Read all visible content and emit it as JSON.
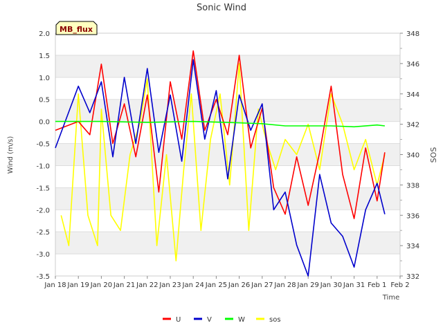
{
  "chart_data": {
    "type": "line",
    "title": "Sonic Wind",
    "xlabel": "Time",
    "ylabel": "Wind (m/s)",
    "y2label": "SOS",
    "site_label": "MB_flux",
    "xlim": [
      "2024-01-18",
      "2024-02-02"
    ],
    "ylim": [
      -3.5,
      2.0
    ],
    "y2lim": [
      332,
      348
    ],
    "x_tick_labels": [
      "Jan 18",
      "Jan 19",
      "Jan 20",
      "Jan 21",
      "Jan 22",
      "Jan 23",
      "Jan 24",
      "Jan 25",
      "Jan 26",
      "Jan 27",
      "Jan 28",
      "Jan 29",
      "Jan 30",
      "Jan 31",
      "Feb 1",
      "Feb 2"
    ],
    "y_tick_labels": [
      "-3.5",
      "-3.0",
      "-2.5",
      "-2.0",
      "-1.5",
      "-1.0",
      "-0.5",
      "0.0",
      "0.5",
      "1.0",
      "1.5",
      "2.0"
    ],
    "y2_tick_labels": [
      "332",
      "334",
      "336",
      "338",
      "340",
      "342",
      "344",
      "346",
      "348"
    ],
    "grid": true,
    "background_bands": "alternating light gray horizontal bands",
    "legend_position": "bottom-center",
    "series": [
      {
        "name": "U",
        "color": "#ff0000",
        "axis": "left",
        "x": [
          "2024-01-18",
          "2024-01-19",
          "2024-01-19 12:00",
          "2024-01-20",
          "2024-01-20 12:00",
          "2024-01-21",
          "2024-01-21 12:00",
          "2024-01-22",
          "2024-01-22 12:00",
          "2024-01-23",
          "2024-01-23 12:00",
          "2024-01-24",
          "2024-01-24 12:00",
          "2024-01-25",
          "2024-01-25 12:00",
          "2024-01-26",
          "2024-01-26 12:00",
          "2024-01-27",
          "2024-01-27 12:00",
          "2024-01-28",
          "2024-01-28 12:00",
          "2024-01-29",
          "2024-01-29 12:00",
          "2024-01-30",
          "2024-01-30 12:00",
          "2024-01-31",
          "2024-01-31 12:00",
          "2024-02-01",
          "2024-02-01 08:00"
        ],
        "values": [
          -0.2,
          0.0,
          -0.3,
          1.3,
          -0.5,
          0.4,
          -0.8,
          0.6,
          -1.6,
          0.9,
          -0.4,
          1.6,
          -0.2,
          0.5,
          -0.3,
          1.5,
          -0.6,
          0.3,
          -1.5,
          -2.1,
          -0.8,
          -1.9,
          -0.7,
          0.8,
          -1.2,
          -2.2,
          -0.6,
          -1.8,
          -0.7
        ]
      },
      {
        "name": "V",
        "color": "#0000cc",
        "axis": "left",
        "x": [
          "2024-01-18",
          "2024-01-19",
          "2024-01-19 12:00",
          "2024-01-20",
          "2024-01-20 12:00",
          "2024-01-21",
          "2024-01-21 12:00",
          "2024-01-22",
          "2024-01-22 12:00",
          "2024-01-23",
          "2024-01-23 12:00",
          "2024-01-24",
          "2024-01-24 12:00",
          "2024-01-25",
          "2024-01-25 12:00",
          "2024-01-26",
          "2024-01-26 12:00",
          "2024-01-27",
          "2024-01-27 12:00",
          "2024-01-28",
          "2024-01-28 12:00",
          "2024-01-29",
          "2024-01-29 12:00",
          "2024-01-30",
          "2024-01-30 12:00",
          "2024-01-31",
          "2024-01-31 12:00",
          "2024-02-01",
          "2024-02-01 08:00"
        ],
        "values": [
          -0.6,
          0.8,
          0.2,
          0.9,
          -0.8,
          1.0,
          -0.5,
          1.2,
          -0.7,
          0.6,
          -0.9,
          1.4,
          -0.4,
          0.7,
          -1.3,
          0.6,
          -0.2,
          0.4,
          -2.0,
          -1.6,
          -2.8,
          -3.5,
          -1.2,
          -2.3,
          -2.6,
          -3.3,
          -2.0,
          -1.4,
          -2.1
        ]
      },
      {
        "name": "W",
        "color": "#00ff00",
        "axis": "left",
        "x": [
          "2024-01-18",
          "2024-01-20",
          "2024-01-22",
          "2024-01-24",
          "2024-01-26",
          "2024-01-27",
          "2024-01-28",
          "2024-01-29",
          "2024-01-30",
          "2024-01-31",
          "2024-02-01",
          "2024-02-01 08:00"
        ],
        "values": [
          0.0,
          0.0,
          -0.02,
          0.0,
          -0.03,
          -0.05,
          -0.1,
          -0.1,
          -0.1,
          -0.12,
          -0.08,
          -0.1
        ]
      },
      {
        "name": "sos",
        "color": "#ffff00",
        "axis": "right",
        "x": [
          "2024-01-18 06:00",
          "2024-01-18 14:00",
          "2024-01-19",
          "2024-01-19 10:00",
          "2024-01-19 20:00",
          "2024-01-20",
          "2024-01-20 10:00",
          "2024-01-20 20:00",
          "2024-01-21 06:00",
          "2024-01-21 16:00",
          "2024-01-22",
          "2024-01-22 10:00",
          "2024-01-22 20:00",
          "2024-01-23 06:00",
          "2024-01-23 14:00",
          "2024-01-23 22:00",
          "2024-01-24 08:00",
          "2024-01-24 18:00",
          "2024-01-25 04:00",
          "2024-01-25 14:00",
          "2024-01-26",
          "2024-01-26 10:00",
          "2024-01-26 20:00",
          "2024-01-27 04:00",
          "2024-01-27 14:00",
          "2024-01-28",
          "2024-01-28 12:00",
          "2024-01-29",
          "2024-01-29 12:00",
          "2024-01-30",
          "2024-01-30 12:00",
          "2024-01-31",
          "2024-01-31 12:00",
          "2024-02-01",
          "2024-02-01 08:00"
        ],
        "values": [
          336,
          334,
          344,
          336,
          334,
          343,
          336,
          335,
          340,
          342,
          345,
          334,
          340,
          333,
          339,
          344,
          335,
          341,
          344,
          338,
          346,
          335,
          343,
          341,
          339,
          341,
          340,
          342,
          339,
          344,
          342,
          339,
          341,
          338,
          340
        ]
      }
    ]
  }
}
